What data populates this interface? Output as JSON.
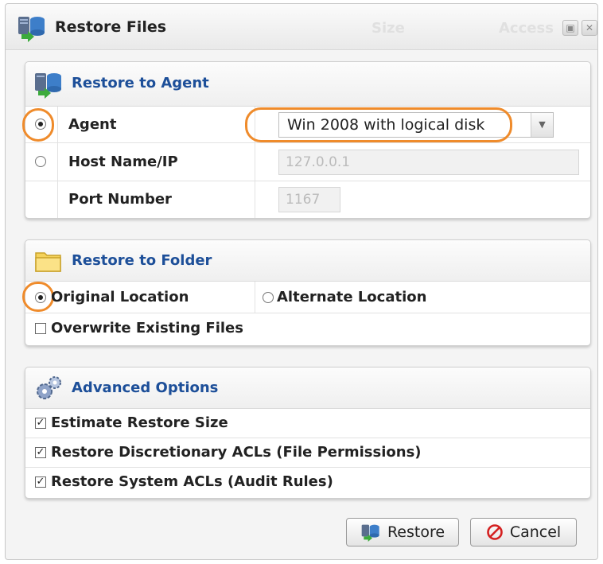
{
  "dialog": {
    "title": "Restore Files",
    "background_columns": [
      "Size",
      "Access"
    ],
    "window_buttons": [
      "restore-window",
      "close-window"
    ]
  },
  "restore_to_agent": {
    "title": "Restore to Agent",
    "rows": [
      {
        "label": "Agent",
        "selected": true,
        "value": "Win 2008 with logical disk"
      },
      {
        "label": "Host Name/IP",
        "selected": false,
        "value": "127.0.0.1"
      },
      {
        "label": "Port Number",
        "value": "1167"
      }
    ]
  },
  "restore_to_folder": {
    "title": "Restore to Folder",
    "original_location": "Original Location",
    "alternate_location": "Alternate Location",
    "original_selected": true,
    "overwrite_label": "Overwrite Existing Files",
    "overwrite_checked": false
  },
  "advanced_options": {
    "title": "Advanced Options",
    "options": [
      {
        "label": "Estimate Restore Size",
        "checked": true
      },
      {
        "label": "Restore Discretionary ACLs (File Permissions)",
        "checked": true
      },
      {
        "label": "Restore System ACLs (Audit Rules)",
        "checked": true
      }
    ]
  },
  "buttons": {
    "restore": "Restore",
    "cancel": "Cancel"
  },
  "colors": {
    "accent_title": "#1d4f99",
    "highlight": "#ef8b2b",
    "cancel_icon": "#d42020"
  }
}
